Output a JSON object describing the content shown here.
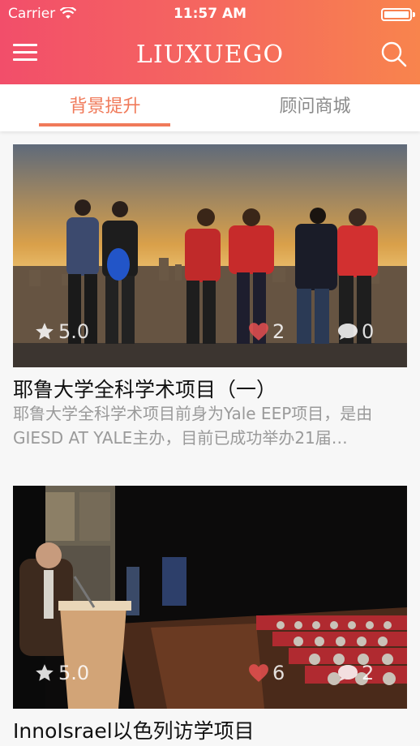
{
  "status": {
    "carrier": "Carrier",
    "time": "11:57 AM"
  },
  "navbar": {
    "brand": "LIUXUEGO"
  },
  "tabs": [
    {
      "label": "背景提升",
      "active": true
    },
    {
      "label": "顾问商城",
      "active": false
    }
  ],
  "cards": [
    {
      "title": "耶鲁大学全科学术项目（一）",
      "description": "耶鲁大学全科学术项目前身为Yale EEP项目，是由GIESD AT YALE主办，目前已成功举办21届…",
      "rating": "5.0",
      "likes": "2",
      "comments": "0"
    },
    {
      "title": "InnoIsrael以色列访学项目",
      "rating": "5.0",
      "likes": "6",
      "comments": "2"
    }
  ],
  "colors": {
    "accent": "#f07a5a",
    "header_start": "#f24e6a",
    "header_end": "#f8844d"
  }
}
